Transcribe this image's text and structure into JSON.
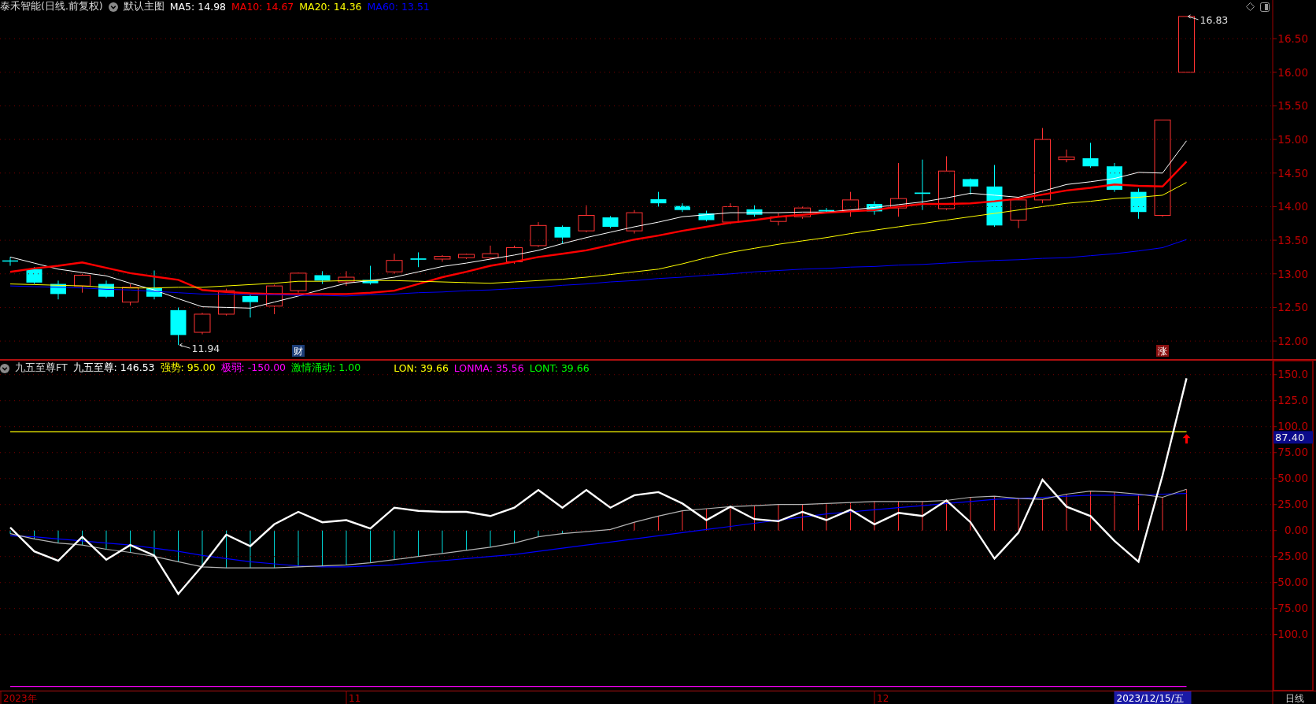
{
  "main_pane": {
    "title": "泰禾智能(日线.前复权)",
    "template": "默认主图",
    "legend_values": [
      "14.98",
      "14.67",
      "14.36",
      "13.51"
    ],
    "event_badges": [
      {
        "label": "财",
        "color": "#1c3d78"
      },
      {
        "label": "涨",
        "color": "#8a1010"
      }
    ],
    "chart_data": {
      "type": "line",
      "ylim": [
        11.72,
        17.075
      ],
      "grid": true,
      "yticks": [
        {
          "value": 16.5,
          "label": "16.50"
        },
        {
          "value": 16,
          "label": "16.00"
        },
        {
          "value": 15.5,
          "label": "15.50"
        },
        {
          "value": 15,
          "label": "15.00"
        },
        {
          "value": 14.5,
          "label": "14.50"
        },
        {
          "value": 14,
          "label": "14.00"
        },
        {
          "value": 13.5,
          "label": "13.50"
        },
        {
          "value": 13,
          "label": "13.00"
        },
        {
          "value": 12.5,
          "label": "12.50"
        },
        {
          "value": 12,
          "label": "12.00"
        }
      ],
      "series": [
        {
          "name": "MA5:",
          "color": "#ffffff",
          "values": [
            13.25,
            13.16,
            13.07,
            13.02,
            12.97,
            12.86,
            12.76,
            12.63,
            12.51,
            12.5,
            12.49,
            12.58,
            12.67,
            12.77,
            12.86,
            12.9,
            12.95,
            13.03,
            13.11,
            13.16,
            13.22,
            13.28,
            13.35,
            13.45,
            13.54,
            13.62,
            13.7,
            13.77,
            13.85,
            13.88,
            13.91,
            13.91,
            13.91,
            13.92,
            13.92,
            13.95,
            13.99,
            14.03,
            14.07,
            14.13,
            14.2,
            14.17,
            14.14,
            14.23,
            14.33,
            14.37,
            14.42,
            14.51,
            14.5,
            14.98
          ]
        },
        {
          "name": "MA10:",
          "color": "#ff0000",
          "values": [
            13.03,
            13.08,
            13.12,
            13.17,
            13.09,
            13.01,
            12.96,
            12.91,
            12.76,
            12.73,
            12.71,
            12.7,
            12.7,
            12.7,
            12.7,
            12.72,
            12.75,
            12.85,
            12.95,
            13.03,
            13.12,
            13.18,
            13.25,
            13.3,
            13.35,
            13.43,
            13.51,
            13.57,
            13.64,
            13.7,
            13.76,
            13.8,
            13.85,
            13.88,
            13.91,
            13.93,
            13.95,
            14.0,
            14.04,
            14.04,
            14.05,
            14.08,
            14.12,
            14.18,
            14.24,
            14.28,
            14.33,
            14.31,
            14.3,
            14.67
          ]
        },
        {
          "name": "MA20:",
          "color": "#ffff00",
          "values": [
            12.85,
            12.84,
            12.83,
            12.82,
            12.8,
            12.79,
            12.79,
            12.8,
            12.8,
            12.82,
            12.84,
            12.86,
            12.89,
            12.89,
            12.9,
            12.9,
            12.9,
            12.89,
            12.88,
            12.87,
            12.86,
            12.88,
            12.9,
            12.92,
            12.95,
            12.99,
            13.03,
            13.07,
            13.15,
            13.24,
            13.32,
            13.38,
            13.44,
            13.49,
            13.54,
            13.6,
            13.65,
            13.7,
            13.75,
            13.8,
            13.85,
            13.9,
            13.95,
            14.0,
            14.05,
            14.08,
            14.12,
            14.14,
            14.17,
            14.36
          ]
        },
        {
          "name": "MA60:",
          "color": "#0000ff",
          "values": [
            12.82,
            12.81,
            12.8,
            12.79,
            12.77,
            12.76,
            12.74,
            12.72,
            12.7,
            12.7,
            12.69,
            12.69,
            12.68,
            12.68,
            12.67,
            12.69,
            12.7,
            12.72,
            12.73,
            12.75,
            12.76,
            12.78,
            12.8,
            12.83,
            12.85,
            12.88,
            12.9,
            12.93,
            12.95,
            12.98,
            13.0,
            13.03,
            13.05,
            13.07,
            13.08,
            13.1,
            13.11,
            13.13,
            13.14,
            13.16,
            13.18,
            13.2,
            13.21,
            13.23,
            13.24,
            13.27,
            13.3,
            13.34,
            13.39,
            13.51
          ]
        }
      ],
      "annotations": [
        "11.94",
        "16.83"
      ]
    }
  },
  "indicator_pane": {
    "title": "九五至尊FT",
    "legend": [
      {
        "kind": "series",
        "value": "146.53",
        "color": "#ffffff"
      },
      {
        "kind": "series",
        "value": "95.00",
        "color": "#ffff00"
      },
      {
        "kind": "series",
        "value": "-150.00",
        "color": "#ff00ff"
      },
      {
        "kind": "signal",
        "label": "激情涌动:",
        "value": "1.00",
        "color": "#00ff00"
      }
    ],
    "legend_2": [
      {
        "kind": "series",
        "value": "39.66",
        "color": "#ffff00"
      },
      {
        "kind": "series",
        "value": "35.56",
        "color": "#ff00ff"
      },
      {
        "kind": "signal",
        "label": "LONT:",
        "value": "39.66",
        "color": "#00ff00"
      }
    ],
    "cursor_value": "87.40",
    "chart_data": {
      "type": "line",
      "ylim": [
        -154,
        164.2
      ],
      "grid": true,
      "yticks": [
        {
          "value": 150,
          "label": "150.0"
        },
        {
          "value": 125,
          "label": "125.0"
        },
        {
          "value": 100,
          "label": "100.0"
        },
        {
          "value": 75,
          "label": "75.00"
        },
        {
          "value": 50,
          "label": "50.00"
        },
        {
          "value": 25,
          "label": "25.00"
        },
        {
          "value": 0,
          "label": "0.00"
        },
        {
          "value": -25,
          "label": "-25.00"
        },
        {
          "value": -50,
          "label": "-50.00"
        },
        {
          "value": -75,
          "label": "-75.00"
        },
        {
          "value": -100,
          "label": "-100.0"
        }
      ],
      "series": [
        {
          "name": "九五至尊:",
          "color": "#ffffff",
          "values": [
            3,
            -20,
            -29,
            -6,
            -28,
            -14,
            -24,
            -61,
            -34,
            -4,
            -15,
            6,
            18,
            8,
            10,
            2,
            22,
            19,
            18,
            18,
            14,
            22,
            39,
            22,
            39,
            22,
            34,
            37,
            26,
            10,
            23,
            11,
            9,
            18,
            10,
            20,
            6,
            17,
            14,
            29,
            8,
            -27,
            -2,
            49,
            23,
            14,
            -10,
            -30,
            53,
            146.5
          ]
        },
        {
          "name": "强势:",
          "color": "#ffff00",
          "values": [
            95,
            95,
            95,
            95,
            95,
            95,
            95,
            95,
            95,
            95,
            95,
            95,
            95,
            95,
            95,
            95,
            95,
            95,
            95,
            95,
            95,
            95,
            95,
            95,
            95,
            95,
            95,
            95,
            95,
            95,
            95,
            95,
            95,
            95,
            95,
            95,
            95,
            95,
            95,
            95,
            95,
            95,
            95,
            95,
            95,
            95,
            95,
            95,
            95,
            95
          ]
        },
        {
          "name": "极弱:",
          "color": "#ff00ff",
          "values": [
            -150,
            -150,
            -150,
            -150,
            -150,
            -150,
            -150,
            -150,
            -150,
            -150,
            -150,
            -150,
            -150,
            -150,
            -150,
            -150,
            -150,
            -150,
            -150,
            -150,
            -150,
            -150,
            -150,
            -150,
            -150,
            -150,
            -150,
            -150,
            -150,
            -150,
            -150,
            -150,
            -150,
            -150,
            -150,
            -150,
            -150,
            -150,
            -150,
            -150,
            -150,
            -150,
            -150,
            -150,
            -150,
            -150,
            -150,
            -150,
            -150,
            -150
          ]
        },
        {
          "name": "LON:",
          "color": "#b4b4b4",
          "values": [
            -3,
            -8,
            -12,
            -14,
            -18,
            -21,
            -25,
            -30,
            -35,
            -36,
            -36,
            -36,
            -35,
            -34,
            -33,
            -31,
            -28,
            -25,
            -22,
            -19,
            -16,
            -12,
            -6,
            -3,
            -1,
            1,
            8,
            14,
            19,
            21,
            23,
            24,
            25,
            25,
            26,
            27,
            28,
            28,
            28,
            29,
            32,
            33,
            31,
            30,
            35,
            38,
            37,
            35,
            32,
            39.7
          ]
        },
        {
          "name": "LONMA:",
          "color": "#0000ff",
          "values": [
            -5,
            -6,
            -8,
            -10,
            -12,
            -14,
            -17,
            -20,
            -24,
            -27,
            -30,
            -32,
            -34,
            -35,
            -35,
            -34,
            -33,
            -31,
            -29,
            -27,
            -25,
            -23,
            -20,
            -17,
            -14,
            -11,
            -8,
            -5,
            -2,
            1,
            4,
            7,
            10,
            13,
            16,
            18,
            20,
            22,
            24,
            26,
            28,
            30,
            31,
            32,
            33,
            34,
            34,
            34,
            35,
            35.6
          ]
        }
      ]
    }
  },
  "time_axis": {
    "labels": [
      "2023年",
      "11",
      "12"
    ],
    "cursor_date": "2023/12/15/五",
    "period": "日线"
  }
}
